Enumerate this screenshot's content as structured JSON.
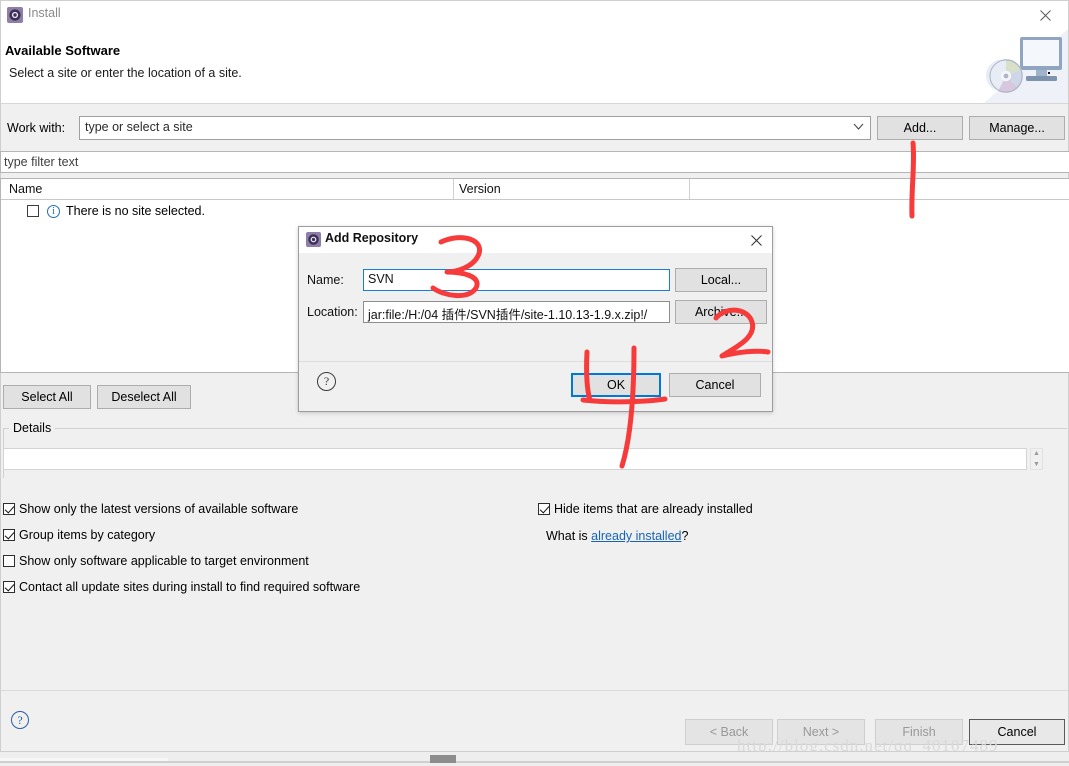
{
  "window": {
    "title": "Install",
    "icon": "eclipse-install-icon",
    "close_icon": "close-icon"
  },
  "header": {
    "title": "Available Software",
    "subtitle": "Select a site or enter the location of a site.",
    "art_icon": "monitor-cd-icon"
  },
  "work_with": {
    "label": "Work with:",
    "value": "type or select a site",
    "dropdown_icon": "chevron-down-icon",
    "add_label": "Add...",
    "manage_label": "Manage..."
  },
  "filter": {
    "placeholder": "type filter text"
  },
  "table": {
    "columns": [
      "Name",
      "Version"
    ],
    "rows": [
      {
        "checked": false,
        "icon": "info-icon",
        "label": "There is no site selected."
      }
    ]
  },
  "selection_buttons": {
    "select_all": "Select All",
    "deselect_all": "Deselect All"
  },
  "details": {
    "group_title": "Details",
    "value": "",
    "scroll_up_icon": "scroll-up-icon",
    "scroll_down_icon": "scroll-down-icon"
  },
  "options": {
    "left": [
      {
        "label": "Show only the latest versions of available software",
        "checked": true
      },
      {
        "label": "Group items by category",
        "checked": true
      },
      {
        "label": "Show only software applicable to target environment",
        "checked": false
      },
      {
        "label": "Contact all update sites during install to find required software",
        "checked": true
      }
    ],
    "right": [
      {
        "label": "Hide items that are already installed",
        "checked": true
      }
    ],
    "what_is_prefix": "What is ",
    "what_is_link": "already installed",
    "what_is_suffix": "?"
  },
  "footer": {
    "help_icon": "help-icon",
    "back": "< Back",
    "next": "Next >",
    "finish": "Finish",
    "cancel": "Cancel"
  },
  "add_repository_dialog": {
    "title": "Add Repository",
    "icon": "eclipse-install-icon",
    "close_icon": "close-icon",
    "name_label": "Name:",
    "name_value": "SVN",
    "location_label": "Location:",
    "location_value": "jar:file:/H:/04 插件/SVN插件/site-1.10.13-1.9.x.zip!/",
    "local_label": "Local...",
    "archive_label": "Archive...",
    "ok_label": "OK",
    "cancel_label": "Cancel",
    "help_icon": "help-icon"
  },
  "annotations": {
    "color": "#f73b3b",
    "marks": [
      {
        "name": "mark-1-under-add-button",
        "text": "1"
      },
      {
        "name": "mark-2-under-archive-button",
        "text": "2"
      },
      {
        "name": "mark-3-over-name-field",
        "text": "3"
      },
      {
        "name": "mark-4-over-ok-button",
        "text": "4"
      }
    ]
  },
  "watermark": {
    "text": "http://blog.csdn.net/qq_40107489"
  }
}
